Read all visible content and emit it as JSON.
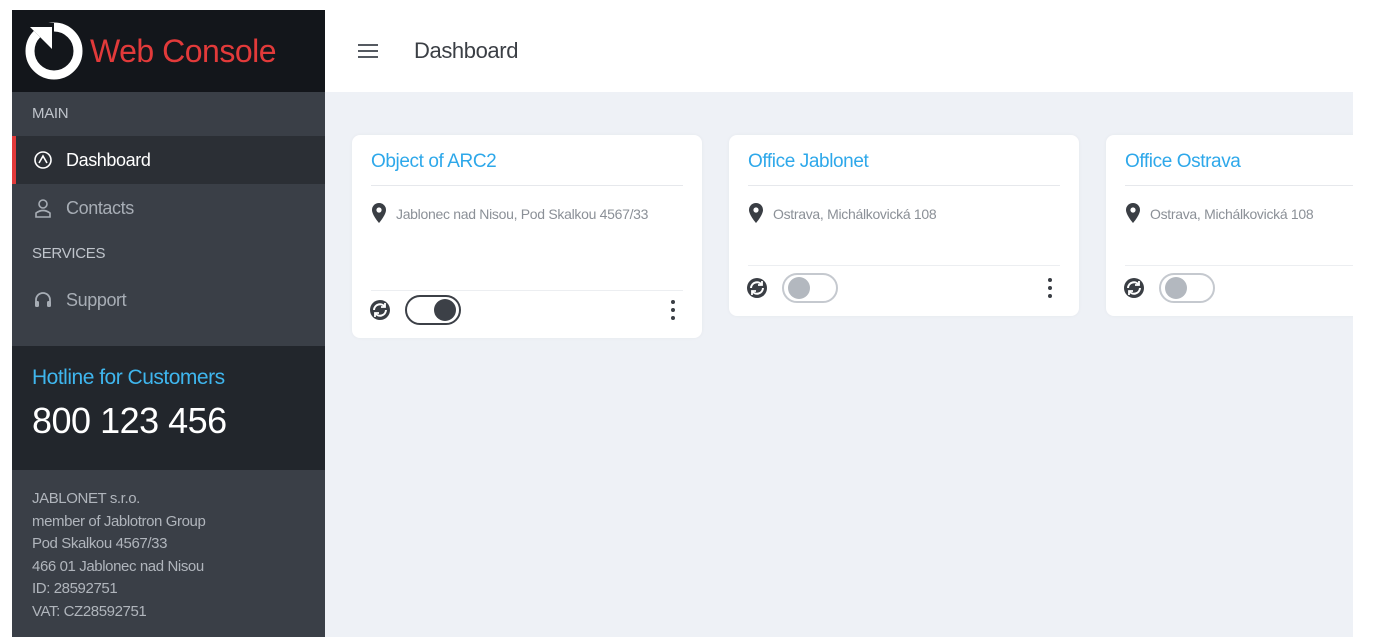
{
  "brand": {
    "name": "Web Console",
    "icon": "power-logo-icon"
  },
  "sidebar": {
    "sections": [
      {
        "label": "MAIN"
      },
      {
        "label": "SERVICES"
      }
    ],
    "items": [
      {
        "label": "Dashboard",
        "icon": "dashboard-gauge-icon",
        "active": true
      },
      {
        "label": "Contacts",
        "icon": "person-icon",
        "active": false
      },
      {
        "label": "Support",
        "icon": "headset-icon",
        "active": false
      }
    ],
    "hotline": {
      "title": "Hotline for Customers",
      "number": "800 123 456"
    },
    "address": [
      "JABLONET s.r.o.",
      "member of Jablotron Group",
      "Pod Skalkou 4567/33",
      "466 01 Jablonec nad Nisou",
      "ID: 28592751",
      "VAT: CZ28592751"
    ]
  },
  "header": {
    "title": "Dashboard",
    "menu_icon": "hamburger-menu-icon"
  },
  "cards": [
    {
      "title": "Object of ARC2",
      "address": "Jablonec nad Nisou, Pod Skalkou 4567/33",
      "toggle": "on"
    },
    {
      "title": "Office Jablonet",
      "address": "Ostrava, Michálkovická 108",
      "toggle": "off"
    },
    {
      "title": "Office Ostrava",
      "address": "Ostrava, Michálkovická 108",
      "toggle": "off"
    }
  ],
  "colors": {
    "brand_red": "#e23a3a",
    "accent_blue": "#2ea8ea",
    "sidebar_bg": "#3a3f47",
    "content_bg": "#eef1f6"
  }
}
